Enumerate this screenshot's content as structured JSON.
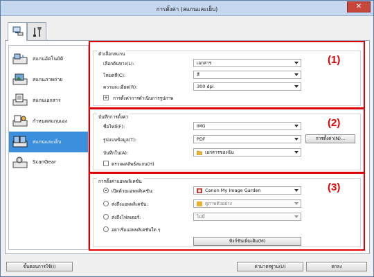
{
  "window": {
    "title": "การตั้งค่า (สแกนและเย็บ)"
  },
  "sidebar": {
    "items": [
      {
        "label": "สแกนอัตโนมัติ",
        "icon": "auto-scan-icon"
      },
      {
        "label": "สแกนภาพถ่าย",
        "icon": "photo-scan-icon"
      },
      {
        "label": "สแกนเอกสาร",
        "icon": "document-scan-icon"
      },
      {
        "label": "กำหนดสแกนเอง",
        "icon": "custom-scan-icon"
      },
      {
        "label": "สแกนและเย็บ",
        "icon": "scan-stitch-icon"
      },
      {
        "label": "ScanGear",
        "icon": "scangear-icon"
      }
    ],
    "active_index": 4
  },
  "scan_options": {
    "title": "ตัวเลือกสแกน",
    "marker": "(1)",
    "select_source_label": "เลือกต้นทาง(L):",
    "select_source_value": "เอกสาร",
    "color_mode_label": "โหมดสี(C):",
    "color_mode_value": "สี",
    "resolution_label": "ความละเอียด(R):",
    "resolution_value": "300 dpi",
    "image_processing_label": "การตั้งค่าการดำเนินการรูปภาพ"
  },
  "save_settings": {
    "title": "บันทึกการตั้งค่า",
    "marker": "(2)",
    "file_name_label": "ชื่อไฟล์(F):",
    "file_name_value": "IMG",
    "data_format_label": "รูปแบบข้อมูล(T):",
    "data_format_value": "PDF",
    "settings_button": "การตั้งค่า(N)...",
    "save_in_label": "บันทึกใน(A):",
    "save_in_value": "เอกสารของฉัน",
    "check_results_label": "ตรวจผลลัพธ์สแกน(H)"
  },
  "app_settings": {
    "title": "การตั้งค่าแอพพลิเคชัน",
    "marker": "(3)",
    "open_with_label": "เปิดด้วยแอพพลิเคชัน:",
    "open_with_value": "Canon My Image Garden",
    "send_to_app_label": "ส่งถึงแอพพลิเคชัน:",
    "send_to_app_value": "ดูภาพตัวอย่าง",
    "send_to_folder_label": "ส่งถึงโฟลเดอร์:",
    "send_to_folder_value": "ไม่มี",
    "no_app_label": "อย่าเริ่มแอพพลิเคชันใด ๆ",
    "more_functions_button": "ฟังก์ชันเพิ่มเติม(M)",
    "selected": "open_with"
  },
  "footer": {
    "instructions_button": "ขั้นตอนการใช้(I)",
    "defaults_button": "ค่ามาตรฐาน(U)",
    "ok_button": "ตกลง"
  }
}
